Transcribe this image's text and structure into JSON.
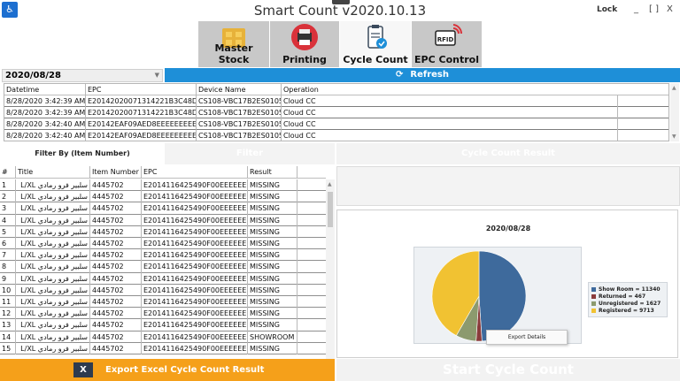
{
  "window": {
    "title": "Smart Count v2020.10.13",
    "lock_label": "Lock",
    "minimize": "_",
    "maximize": "[ ]",
    "close": "X"
  },
  "tabs": [
    {
      "label": "Master Stock",
      "icon": "boxes-icon",
      "active": false
    },
    {
      "label": "Printing",
      "icon": "printer-icon",
      "active": false
    },
    {
      "label": "Cycle Count",
      "icon": "clipboard-check-icon",
      "active": true
    },
    {
      "label": "EPC Control",
      "icon": "rfid-icon",
      "active": false
    }
  ],
  "toolbar": {
    "date_value": "2020/08/28",
    "refresh_label": "Refresh"
  },
  "top_table": {
    "columns": [
      "Datetime",
      "EPC",
      "Device Name",
      "Operation"
    ],
    "rows": [
      [
        "8/28/2020 3:42:39 AM",
        "E20142020071314221B3C48D",
        "CS108-VBC17B2ES0105",
        "Cloud CC"
      ],
      [
        "8/28/2020 3:42:39 AM",
        "E20142020071314221B3C48D",
        "CS108-VBC17B2ES0105",
        "Cloud CC"
      ],
      [
        "8/28/2020 3:42:40 AM",
        "E20142EAF09AED8EEEEEEEEE",
        "CS108-VBC17B2ES0105",
        "Cloud CC"
      ],
      [
        "8/28/2020 3:42:40 AM",
        "E20142EAF09AED8EEEEEEEEE",
        "CS108-VBC17B2ES0105",
        "Cloud CC"
      ]
    ]
  },
  "filter": {
    "label": "Filter By (Item Number)",
    "button": "Filter",
    "ccr_button": "Cycle Count Result"
  },
  "items_table": {
    "columns": [
      "#",
      "Title",
      "Item Number",
      "EPC",
      "Result"
    ],
    "rows": [
      [
        "1",
        "سلبير فرو رمادي L/XL",
        "4445702",
        "E2014116425490F00EEEEEEE",
        "MISSING"
      ],
      [
        "2",
        "سلبير فرو رمادي L/XL",
        "4445702",
        "E2014116425490F00EEEEEEE",
        "MISSING"
      ],
      [
        "3",
        "سلبير فرو رمادي L/XL",
        "4445702",
        "E2014116425490F00EEEEEEE",
        "MISSING"
      ],
      [
        "4",
        "سلبير فرو رمادي L/XL",
        "4445702",
        "E2014116425490F00EEEEEEE",
        "MISSING"
      ],
      [
        "5",
        "سلبير فرو رمادي L/XL",
        "4445702",
        "E2014116425490F00EEEEEEE",
        "MISSING"
      ],
      [
        "6",
        "سلبير فرو رمادي L/XL",
        "4445702",
        "E2014116425490F00EEEEEEE",
        "MISSING"
      ],
      [
        "7",
        "سلبير فرو رمادي L/XL",
        "4445702",
        "E2014116425490F00EEEEEEE",
        "MISSING"
      ],
      [
        "8",
        "سلبير فرو رمادي L/XL",
        "4445702",
        "E2014116425490F00EEEEEEE",
        "MISSING"
      ],
      [
        "9",
        "سلبير فرو رمادي L/XL",
        "4445702",
        "E2014116425490F00EEEEEEE",
        "MISSING"
      ],
      [
        "10",
        "سلبير فرو رمادي L/XL",
        "4445702",
        "E2014116425490F00EEEEEEE",
        "MISSING"
      ],
      [
        "11",
        "سلبير فرو رمادي L/XL",
        "4445702",
        "E2014116425490F00EEEEEEE",
        "MISSING"
      ],
      [
        "12",
        "سلبير فرو رمادي L/XL",
        "4445702",
        "E2014116425490F00EEEEEEE",
        "MISSING"
      ],
      [
        "13",
        "سلبير فرو رمادي L/XL",
        "4445702",
        "E2014116425490F00EEEEEEE",
        "MISSING"
      ],
      [
        "14",
        "سلبير فرو رمادي L/XL",
        "4445702",
        "E2014116425490F00EEEEEEE",
        "SHOWROOM"
      ],
      [
        "15",
        "سلبير فرو رمادي L/XL",
        "4445702",
        "E2014116425490F00EEEEEEE",
        "MISSING"
      ]
    ]
  },
  "export_button": {
    "icon_text": "X",
    "label": "Export Excel Cycle Count Result"
  },
  "start_button": {
    "label": "Start Cycle Count"
  },
  "chart_data": {
    "type": "pie",
    "title": "2020/08/28",
    "slices": [
      {
        "label": "Show Room",
        "value": 11340,
        "color": "#3e6a9c"
      },
      {
        "label": "Returned",
        "value": 467,
        "color": "#8a3b3b"
      },
      {
        "label": "Unregistered",
        "value": 1627,
        "color": "#8c9a6e"
      },
      {
        "label": "Registered",
        "value": 9713,
        "color": "#f1c232"
      }
    ],
    "legend_entries": [
      "Show Room = 11340",
      "Returned = 467",
      "Unregistered = 1627",
      "Registered = 9713"
    ],
    "legend_position": "right",
    "context_menu_item": "Export Details"
  },
  "colors": {
    "refresh_bar": "#1e8fd8",
    "export_button": "#f5a01a",
    "active_tab": "#f7f7f7",
    "inactive_tab": "#c8c8c8"
  }
}
